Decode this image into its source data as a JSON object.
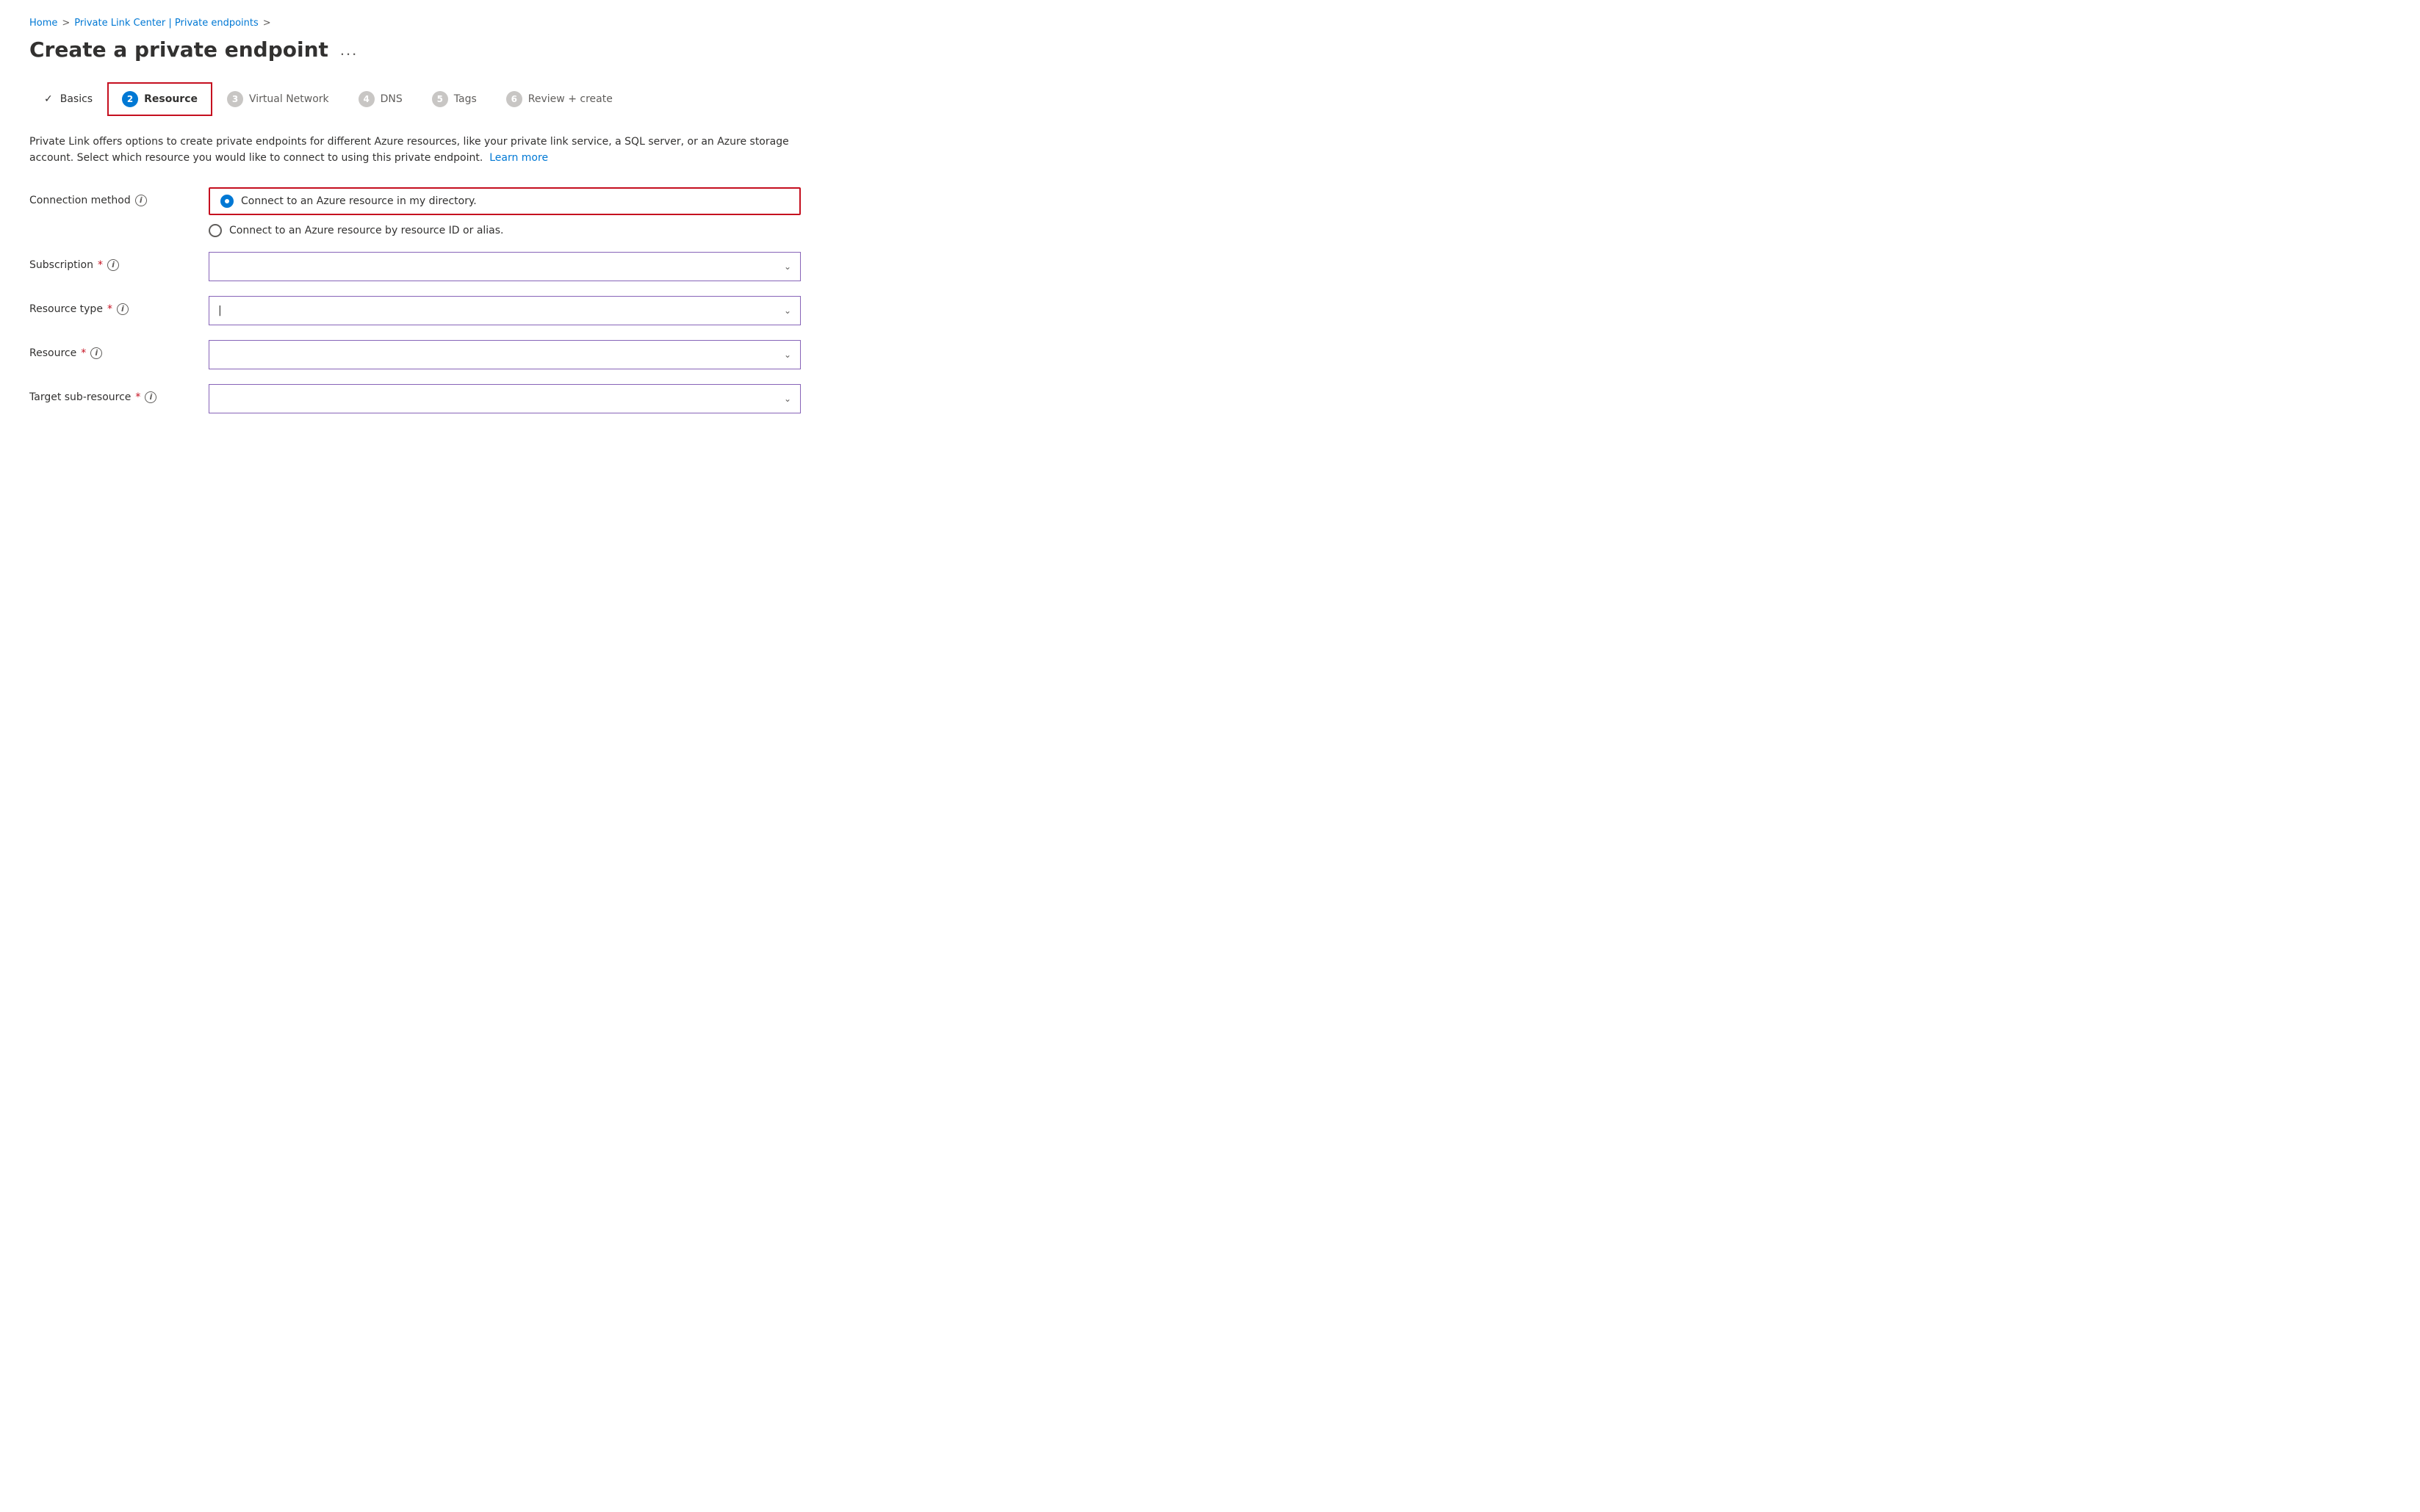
{
  "breadcrumb": {
    "home": "Home",
    "separator1": ">",
    "private_link": "Private Link Center | Private endpoints",
    "separator2": ">"
  },
  "page_title": "Create a private endpoint",
  "ellipsis": "...",
  "steps": [
    {
      "id": "basics",
      "label": "Basics",
      "number": "1",
      "state": "completed",
      "check": "✓"
    },
    {
      "id": "resource",
      "label": "Resource",
      "number": "2",
      "state": "active"
    },
    {
      "id": "virtual-network",
      "label": "Virtual Network",
      "number": "3",
      "state": "default"
    },
    {
      "id": "dns",
      "label": "DNS",
      "number": "4",
      "state": "default"
    },
    {
      "id": "tags",
      "label": "Tags",
      "number": "5",
      "state": "default"
    },
    {
      "id": "review-create",
      "label": "Review + create",
      "number": "6",
      "state": "default"
    }
  ],
  "description": {
    "text": "Private Link offers options to create private endpoints for different Azure resources, like your private link service, a SQL server, or an Azure storage account. Select which resource you would like to connect to using this private endpoint.",
    "learn_more_label": "Learn more"
  },
  "form": {
    "connection_method": {
      "label": "Connection method",
      "options": [
        {
          "id": "directory",
          "label": "Connect to an Azure resource in my directory.",
          "selected": true
        },
        {
          "id": "resource-id",
          "label": "Connect to an Azure resource by resource ID or alias.",
          "selected": false
        }
      ]
    },
    "subscription": {
      "label": "Subscription",
      "required": true,
      "value": "",
      "placeholder": ""
    },
    "resource_type": {
      "label": "Resource type",
      "required": true,
      "value": "",
      "placeholder": ""
    },
    "resource": {
      "label": "Resource",
      "required": true,
      "value": "",
      "placeholder": ""
    },
    "target_sub_resource": {
      "label": "Target sub-resource",
      "required": true,
      "value": "",
      "placeholder": ""
    }
  }
}
